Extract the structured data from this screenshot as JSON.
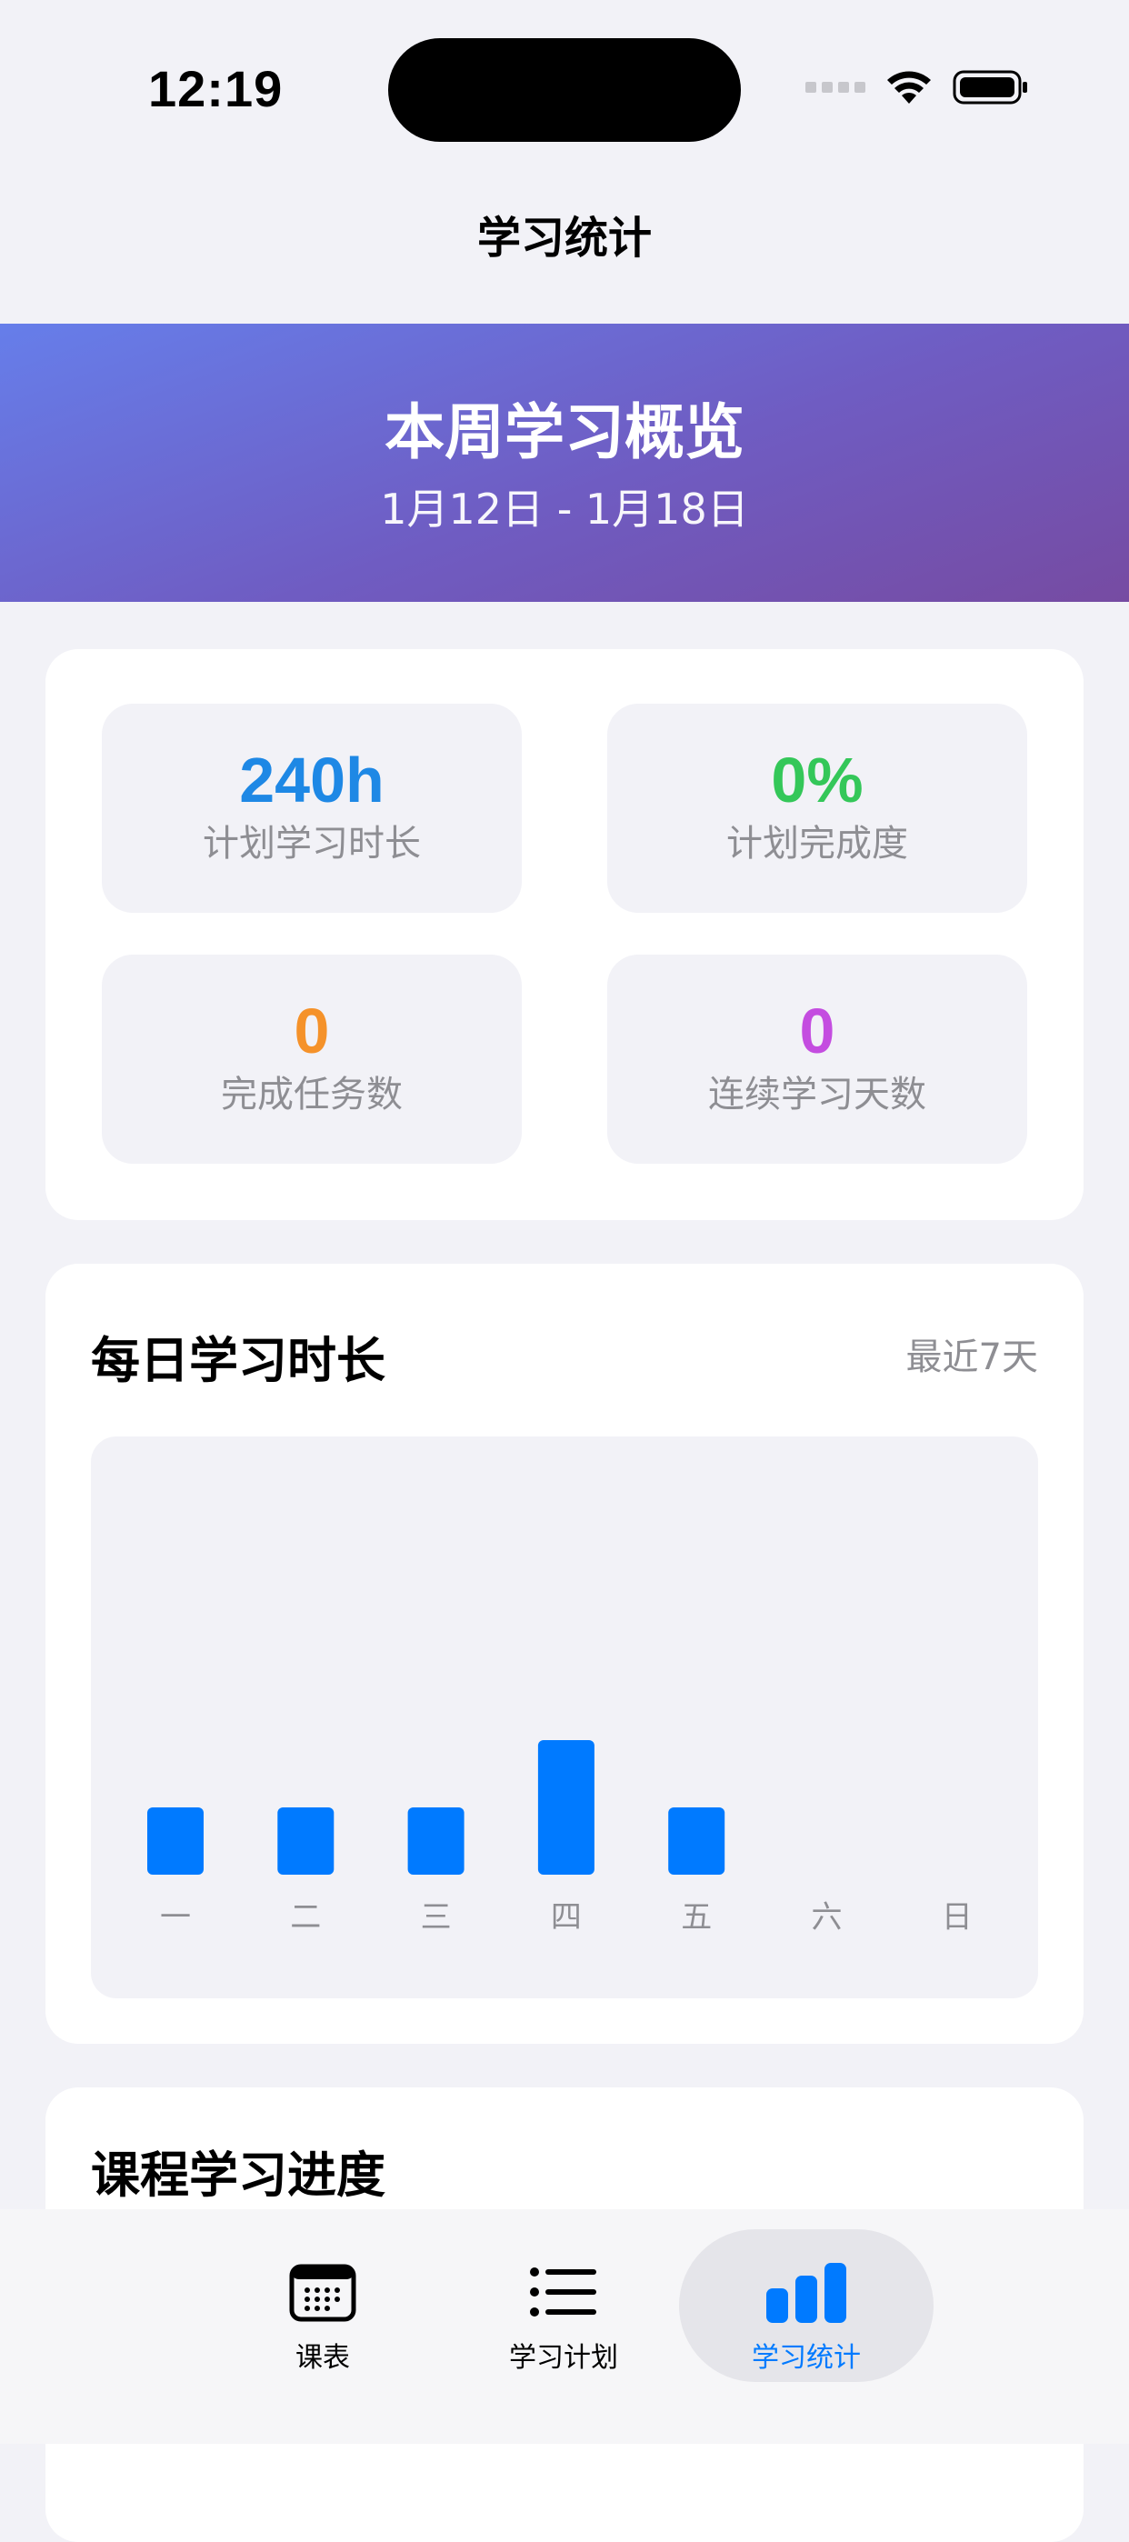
{
  "status_bar": {
    "time": "12:19"
  },
  "nav": {
    "title": "学习统计"
  },
  "banner": {
    "title": "本周学习概览",
    "date_range": "1月12日 - 1月18日"
  },
  "stats": [
    {
      "value": "240h",
      "label": "计划学习时长",
      "color": "#1e88e5"
    },
    {
      "value": "0%",
      "label": "计划完成度",
      "color": "#34c759"
    },
    {
      "value": "0",
      "label": "完成任务数",
      "color": "#f5922a"
    },
    {
      "value": "0",
      "label": "连续学习天数",
      "color": "#c44de0"
    }
  ],
  "daily_chart": {
    "title": "每日学习时长",
    "subtitle": "最近7天",
    "bar_color": "#007aff",
    "label_color": "#8e8e93"
  },
  "chart_data": {
    "type": "bar",
    "categories": [
      "一",
      "二",
      "三",
      "四",
      "五",
      "六",
      "日"
    ],
    "values": [
      1,
      1,
      1,
      2,
      1,
      0,
      0
    ],
    "grid": false
  },
  "progress_section": {
    "title": "课程学习进度"
  },
  "tab_bar": {
    "items": [
      {
        "label": "课表",
        "icon": "calendar-icon",
        "active": false
      },
      {
        "label": "学习计划",
        "icon": "list-icon",
        "active": false
      },
      {
        "label": "学习统计",
        "icon": "bar-chart-icon",
        "active": true
      }
    ],
    "active_color": "#007aff"
  }
}
